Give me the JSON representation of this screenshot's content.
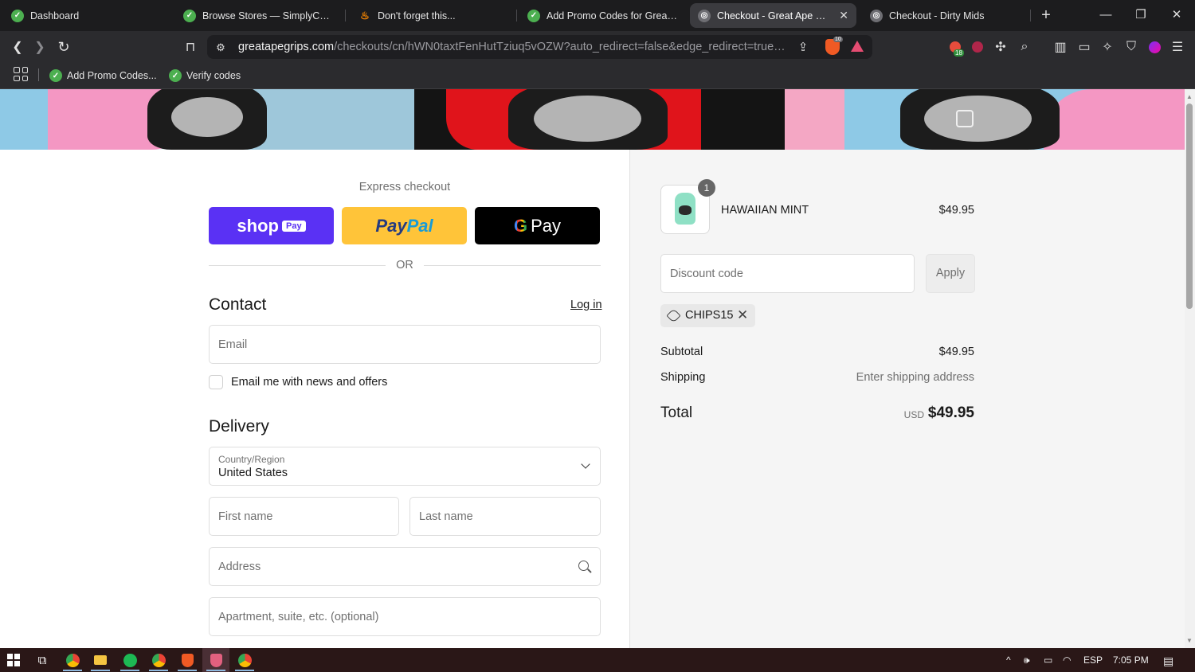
{
  "browser": {
    "tabs": [
      {
        "title": "Dashboard",
        "icon": "simplycodes-icon"
      },
      {
        "title": "Browse Stores — SimplyCodes",
        "icon": "simplycodes-icon"
      },
      {
        "title": "Don't forget this...",
        "icon": "flame-icon"
      },
      {
        "title": "Add Promo Codes for Great Ape",
        "icon": "simplycodes-icon"
      },
      {
        "title": "Checkout - Great Ape Grips",
        "icon": "globe-icon",
        "active": true
      },
      {
        "title": "Checkout - Dirty Mids",
        "icon": "globe-icon"
      }
    ],
    "url_host": "greatapegrips.com",
    "url_path": "/checkouts/cn/hWN0taxtFenHutTziuq5vOZW?auto_redirect=false&edge_redirect=true&local...",
    "shields_count": "10",
    "extension_badge": "18",
    "bookmarks": [
      {
        "label": "Add Promo Codes..."
      },
      {
        "label": "Verify codes"
      }
    ]
  },
  "checkout": {
    "express_title": "Express checkout",
    "shop_pay": {
      "shop": "shop",
      "pay": "Pay"
    },
    "paypal": {
      "p1": "Pay",
      "p2": "Pal"
    },
    "gpay": {
      "g": "G",
      "pay": "Pay"
    },
    "or_text": "OR",
    "contact": {
      "title": "Contact",
      "login": "Log in",
      "email_placeholder": "Email",
      "news_label": "Email me with news and offers"
    },
    "delivery": {
      "title": "Delivery",
      "country_label": "Country/Region",
      "country_value": "United States",
      "first_name": "First name",
      "last_name": "Last name",
      "address": "Address",
      "apartment": "Apartment, suite, etc. (optional)"
    }
  },
  "summary": {
    "item": {
      "quantity": "1",
      "name": "HAWAIIAN MINT",
      "price": "$49.95"
    },
    "discount_placeholder": "Discount code",
    "apply_label": "Apply",
    "applied_code": "CHIPS15",
    "subtotal_label": "Subtotal",
    "subtotal_value": "$49.95",
    "shipping_label": "Shipping",
    "shipping_value": "Enter shipping address",
    "total_label": "Total",
    "total_currency": "USD",
    "total_value": "$49.95"
  },
  "taskbar": {
    "language": "ESP",
    "time": "7:05 PM"
  },
  "colors": {
    "shop_pay": "#5a31f4",
    "paypal": "#ffc439",
    "gpay": "#000000",
    "summary_bg": "#f5f5f5"
  }
}
